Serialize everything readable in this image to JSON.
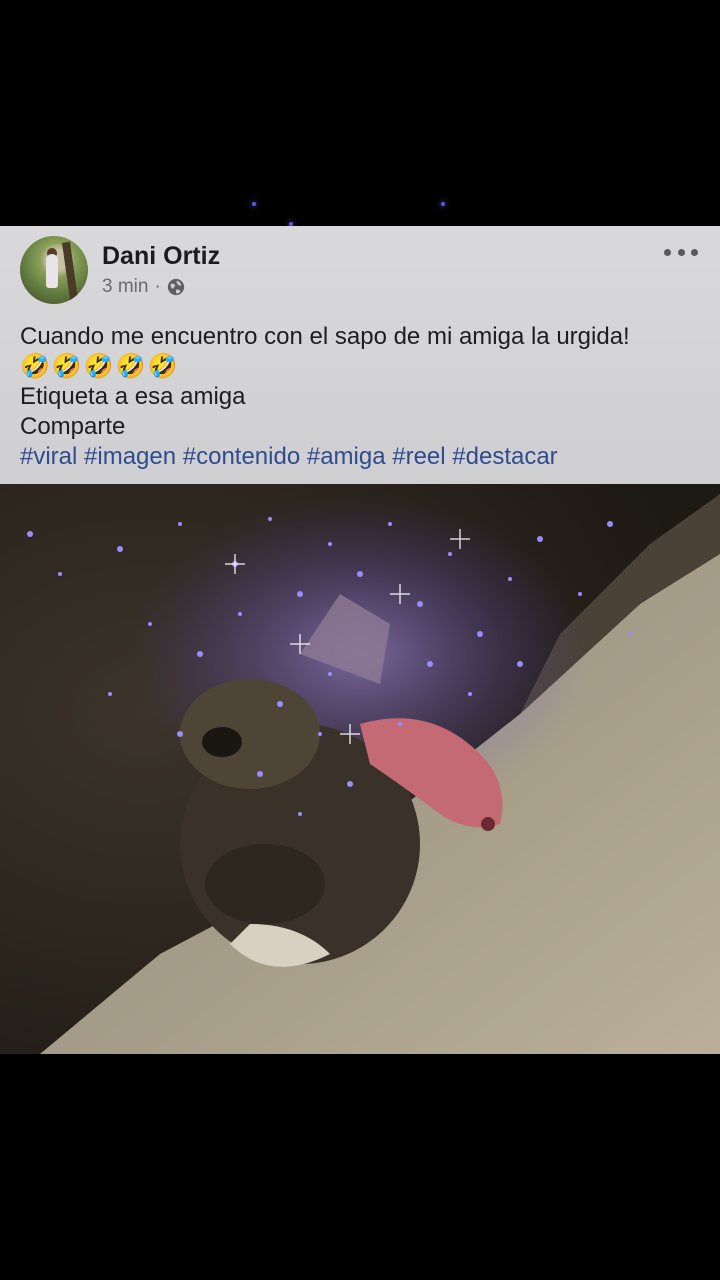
{
  "post": {
    "author": "Dani Ortiz",
    "time": "3 min",
    "separator": "·",
    "visibility_icon": "globe-icon",
    "more_icon": "more-options-icon",
    "text_lines": [
      "Cuando me encuentro con el sapo de mi amiga la urgida!",
      "Etiqueta a esa amiga",
      "Comparte"
    ],
    "emojis": "🤣🤣🤣🤣🤣",
    "hashtags": "#viral #imagen #contenido #amiga #reel #destacar"
  },
  "colors": {
    "post_background": "#d6d6d8",
    "hashtag": "#2e4c8f",
    "sparkle": "#6c5cff"
  }
}
